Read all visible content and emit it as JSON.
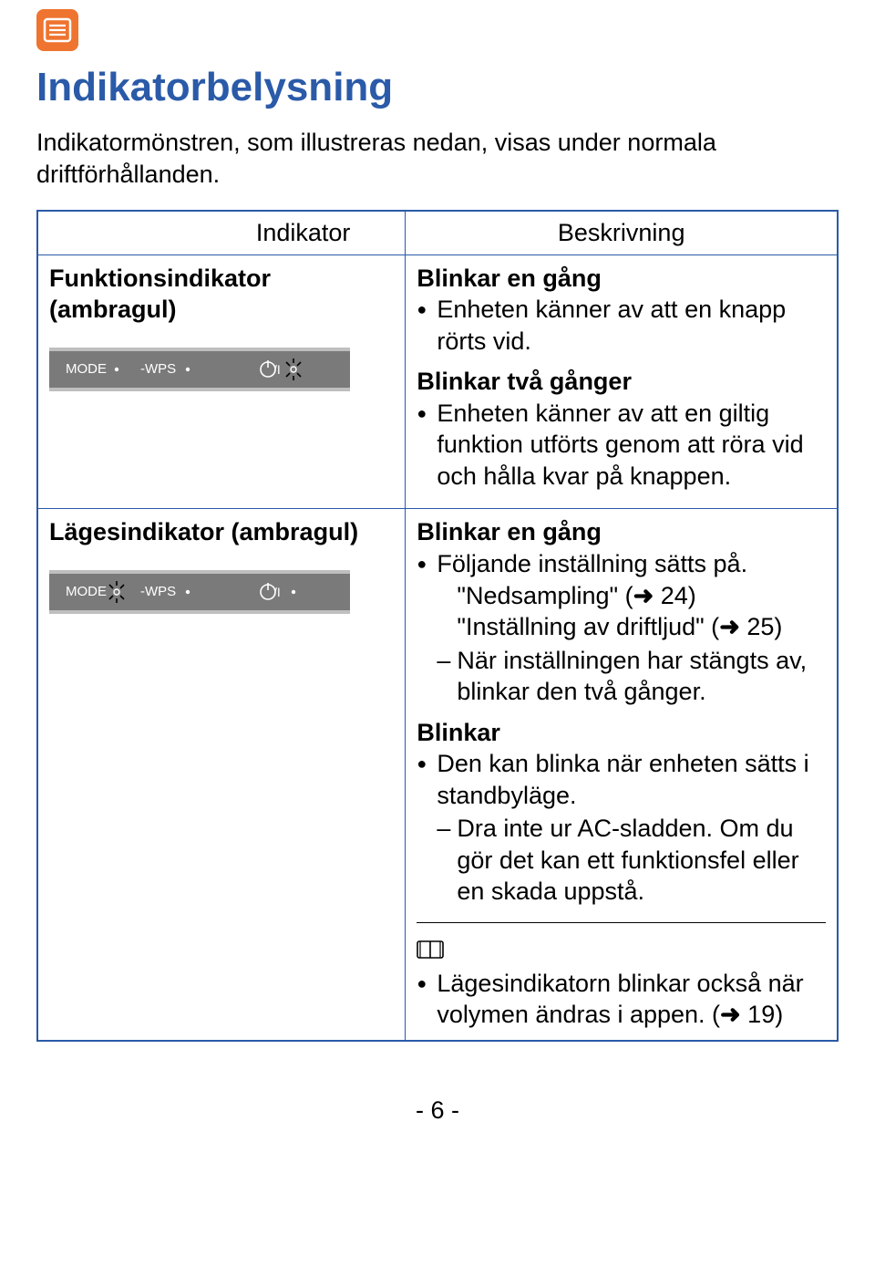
{
  "icon_name": "list-icon",
  "title": "Indikatorbelysning",
  "intro": "Indikatormönstren, som illustreras nedan, visas under normala driftförhållanden.",
  "table": {
    "header": {
      "left": "Indikator",
      "right": "Beskrivning"
    },
    "row1": {
      "label": "Funktionsindikator (ambragul)",
      "panel_labels": {
        "mode": "MODE",
        "wps": "-WPS"
      },
      "desc": {
        "b1_title": "Blinkar en gång",
        "b1_item": "Enheten känner av att en knapp rörts vid.",
        "b2_title": "Blinkar två gånger",
        "b2_item": "Enheten känner av att en giltig funktion utförts genom att röra vid och hålla kvar på knappen."
      }
    },
    "row2": {
      "label": "Lägesindikator (ambragul)",
      "panel_labels": {
        "mode": "MODE",
        "wps": "-WPS"
      },
      "desc": {
        "b1_title": "Blinkar en gång",
        "b1_item": "Följande inställning sätts på.",
        "b1_q1a": "\"Nedsampling\" (",
        "b1_q1_ref": "24)",
        "b1_q2a": "\"Inställning av driftljud\" (",
        "b1_q2_ref": "25)",
        "b1_sub": "När inställningen har stängts av, blinkar den två gånger.",
        "b2_title": "Blinkar",
        "b2_item": "Den kan blinka när enheten sätts i standbyläge.",
        "b2_sub": "Dra inte ur AC-sladden. Om du gör det kan ett funktionsfel eller en skada uppstå.",
        "note_a": "Lägesindikatorn blinkar också när volymen ändras i appen. (",
        "note_ref": "19)"
      }
    }
  },
  "page_number": "- 6 -"
}
